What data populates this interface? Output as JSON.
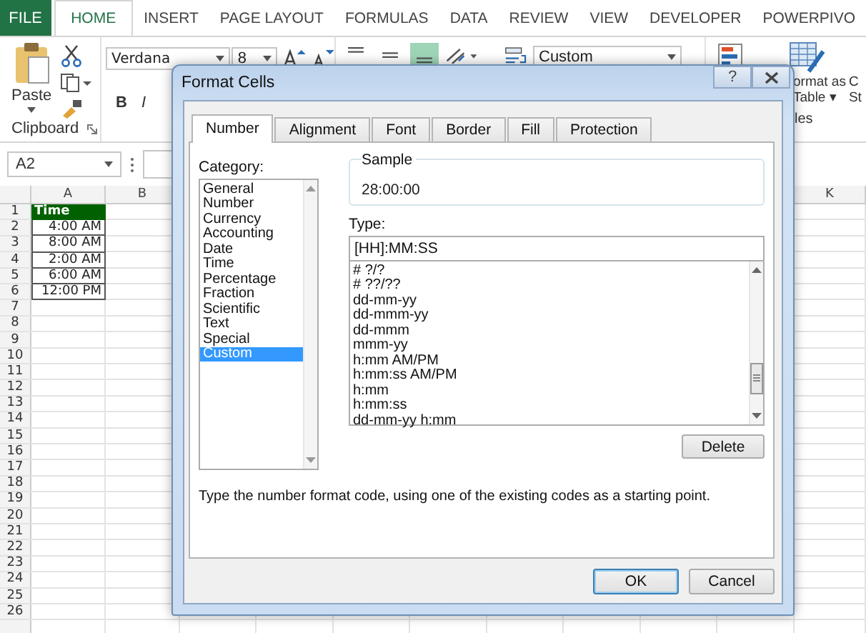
{
  "ribbon": {
    "file_tab": "FILE",
    "tabs": [
      {
        "label": "HOME",
        "selected": true
      },
      {
        "label": "INSERT",
        "selected": false
      },
      {
        "label": "PAGE LAYOUT",
        "selected": false
      },
      {
        "label": "FORMULAS",
        "selected": false
      },
      {
        "label": "DATA",
        "selected": false
      },
      {
        "label": "REVIEW",
        "selected": false
      },
      {
        "label": "VIEW",
        "selected": false
      },
      {
        "label": "DEVELOPER",
        "selected": false
      },
      {
        "label": "POWERPIVO",
        "selected": false
      }
    ],
    "clipboard": {
      "paste": "Paste",
      "group_label": "Clipboard"
    },
    "font": {
      "family": "Verdana",
      "size": "8",
      "bold": "B",
      "italic": "I"
    },
    "alignment": [
      {
        "kind": "top",
        "on": false
      },
      {
        "kind": "middle",
        "on": false
      },
      {
        "kind": "bottom",
        "on": true
      }
    ],
    "number": {
      "format": "Custom"
    },
    "styles": {
      "format_as_table": [
        "ormat as",
        "Table ▾"
      ],
      "cell_styles": [
        "C",
        "St"
      ],
      "group_label": "les"
    }
  },
  "formula_bar": {
    "name_box": "A2"
  },
  "sheet": {
    "column_headers": [
      "A",
      "B",
      "K"
    ],
    "row_numbers": [
      "1",
      "2",
      "3",
      "4",
      "5",
      "6",
      "7",
      "8",
      "9",
      "10",
      "11",
      "12",
      "13",
      "14",
      "15",
      "16",
      "17",
      "18",
      "19",
      "20",
      "21",
      "22",
      "23",
      "24",
      "25",
      "26"
    ],
    "cells": [
      {
        "text": "Time",
        "kind": "header"
      },
      {
        "text": "4:00 AM",
        "kind": "time"
      },
      {
        "text": "8:00 AM",
        "kind": "time"
      },
      {
        "text": "2:00 AM",
        "kind": "time"
      },
      {
        "text": "6:00 AM",
        "kind": "time"
      },
      {
        "text": "12:00 PM",
        "kind": "time"
      }
    ]
  },
  "dialog": {
    "title": "Format Cells",
    "help": "?",
    "tabs": [
      {
        "label": "Number",
        "selected": true
      },
      {
        "label": "Alignment",
        "selected": false
      },
      {
        "label": "Font",
        "selected": false
      },
      {
        "label": "Border",
        "selected": false
      },
      {
        "label": "Fill",
        "selected": false
      },
      {
        "label": "Protection",
        "selected": false
      }
    ],
    "category_label": "Category:",
    "categories": [
      {
        "label": "General",
        "selected": false
      },
      {
        "label": "Number",
        "selected": false
      },
      {
        "label": "Currency",
        "selected": false
      },
      {
        "label": "Accounting",
        "selected": false
      },
      {
        "label": "Date",
        "selected": false
      },
      {
        "label": "Time",
        "selected": false
      },
      {
        "label": "Percentage",
        "selected": false
      },
      {
        "label": "Fraction",
        "selected": false
      },
      {
        "label": "Scientific",
        "selected": false
      },
      {
        "label": "Text",
        "selected": false
      },
      {
        "label": "Special",
        "selected": false
      },
      {
        "label": "Custom",
        "selected": true
      }
    ],
    "sample_label": "Sample",
    "sample_value": "28:00:00",
    "type_label": "Type:",
    "type_value": "[HH]:MM:SS",
    "type_list": [
      "# ?/?",
      "# ??/??",
      "dd-mm-yy",
      "dd-mmm-yy",
      "dd-mmm",
      "mmm-yy",
      "h:mm AM/PM",
      "h:mm:ss AM/PM",
      "h:mm",
      "h:mm:ss",
      "dd-mm-yy h:mm"
    ],
    "delete_button": "Delete",
    "description": "Type the number format code, using one of the existing codes as a starting point.",
    "buttons": [
      {
        "label": "OK",
        "default": true
      },
      {
        "label": "Cancel",
        "default": false
      }
    ]
  }
}
